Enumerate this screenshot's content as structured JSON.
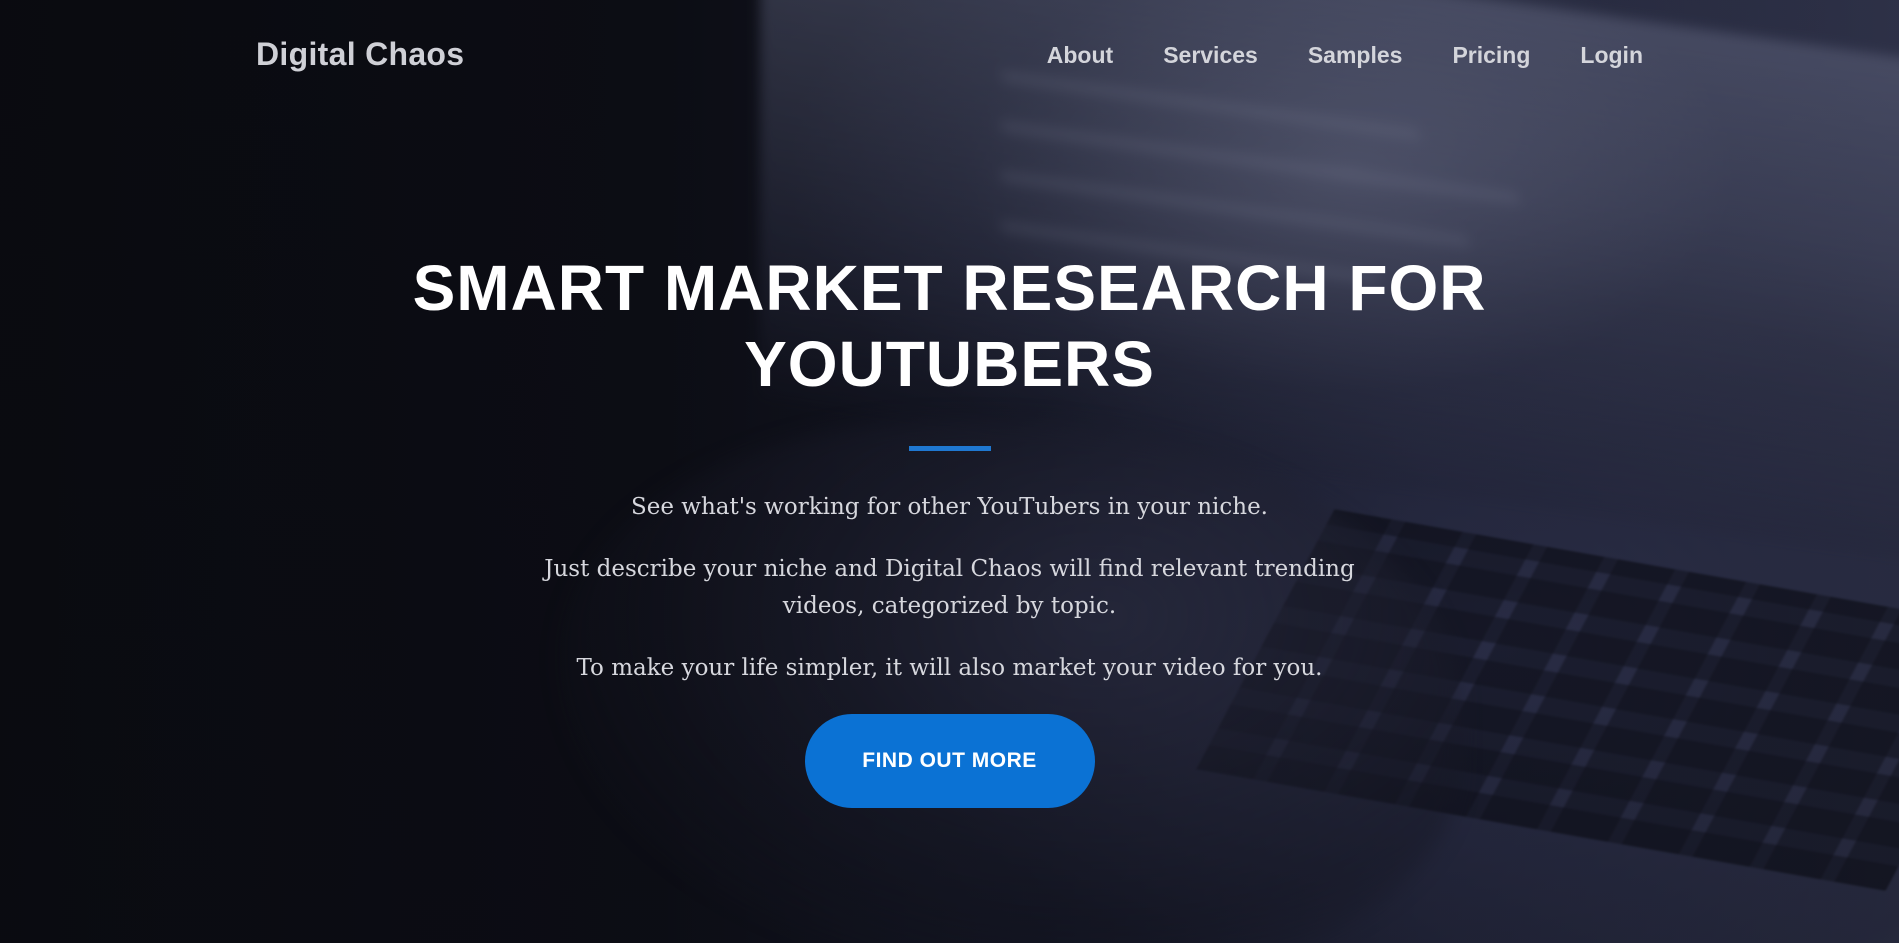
{
  "nav": {
    "brand": "Digital Chaos",
    "links": [
      "About",
      "Services",
      "Samples",
      "Pricing",
      "Login"
    ]
  },
  "hero": {
    "headline": "SMART MARKET RESEARCH FOR YOUTUBERS",
    "paragraphs": [
      "See what's working for other YouTubers in your niche.",
      "Just describe your niche and Digital Chaos will find relevant trending videos, categorized by topic.",
      "To make your life simpler, it will also market your video for you."
    ],
    "cta_label": "FIND OUT MORE"
  },
  "colors": {
    "accent": "#0b72d4",
    "divider": "#1f78d1",
    "text_primary": "#ffffff",
    "text_muted": "#d6d7dd"
  }
}
